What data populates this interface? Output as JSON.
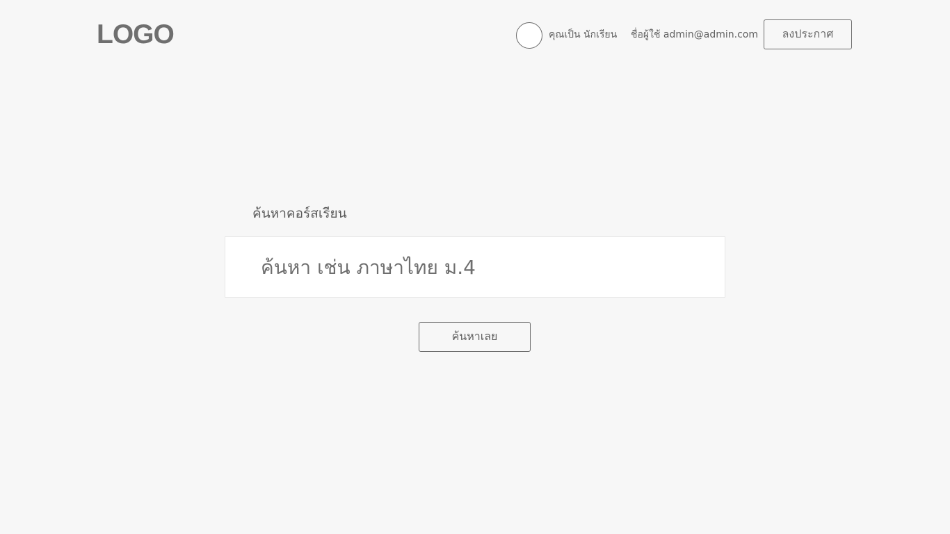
{
  "header": {
    "logo_text": "LOGO",
    "role_text": "คุณเป็น นักเรียน",
    "user_text": "ชื่อผู้ใช้ admin@admin.com",
    "post_button_label": "ลงประกาศ"
  },
  "search": {
    "label": "ค้นหาคอร์สเรียน",
    "placeholder": "ค้นหา เช่น ภาษาไทย ม.4",
    "value": "",
    "button_label": "ค้นหาเลย"
  },
  "colors": {
    "background": "#f7f7f7",
    "text": "#666666",
    "border": "#6a6a6a",
    "input_background": "#ffffff"
  }
}
